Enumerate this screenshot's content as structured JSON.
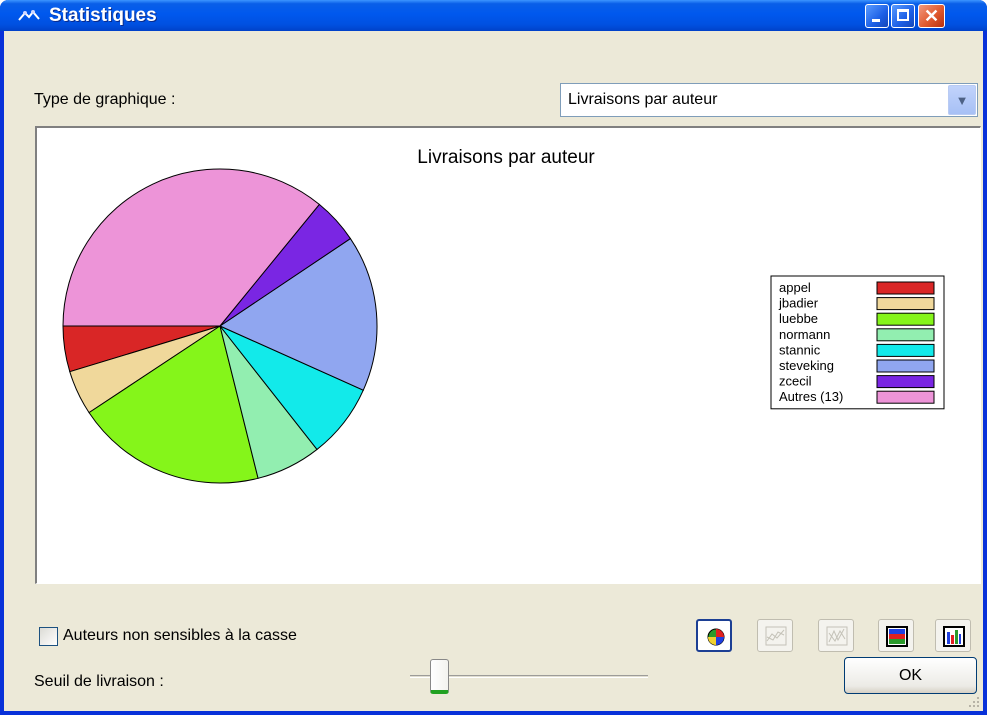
{
  "window": {
    "title": "Statistiques"
  },
  "controls": {
    "chart_type_label": "Type de graphique :",
    "chart_type_value": "Livraisons par auteur",
    "case_checkbox_label": "Auteurs non sensibles à la casse",
    "case_checkbox_checked": false,
    "threshold_label": "Seuil de livraison :",
    "ok_label": "OK",
    "toolbar": [
      {
        "name": "pie-chart-button",
        "icon": "pie-chart-icon",
        "pressed": true,
        "enabled": true
      },
      {
        "name": "line-chart-button",
        "icon": "line-chart-icon",
        "pressed": false,
        "enabled": false
      },
      {
        "name": "area-chart-button",
        "icon": "area-chart-icon",
        "pressed": false,
        "enabled": false
      },
      {
        "name": "stacked-bar-button",
        "icon": "stacked-bar-icon",
        "pressed": false,
        "enabled": true
      },
      {
        "name": "bar-chart-button",
        "icon": "bar-chart-icon",
        "pressed": false,
        "enabled": true
      }
    ]
  },
  "chart_data": {
    "type": "pie",
    "title": "Livraisons par auteur",
    "legend_position": "right",
    "slices": [
      {
        "label": "appel",
        "value": 4.7,
        "color": "#d92626"
      },
      {
        "label": "jbadier",
        "value": 4.6,
        "color": "#f0d89b"
      },
      {
        "label": "luebbe",
        "value": 19.6,
        "color": "#85f51a"
      },
      {
        "label": "normann",
        "value": 6.7,
        "color": "#92eeb0"
      },
      {
        "label": "stannic",
        "value": 7.7,
        "color": "#12eaea"
      },
      {
        "label": "steveking",
        "value": 16.1,
        "color": "#90a6f0"
      },
      {
        "label": "zcecil",
        "value": 4.7,
        "color": "#7a26e3"
      },
      {
        "label": "Autres (13)",
        "value": 35.9,
        "color": "#ed94d8"
      }
    ]
  }
}
